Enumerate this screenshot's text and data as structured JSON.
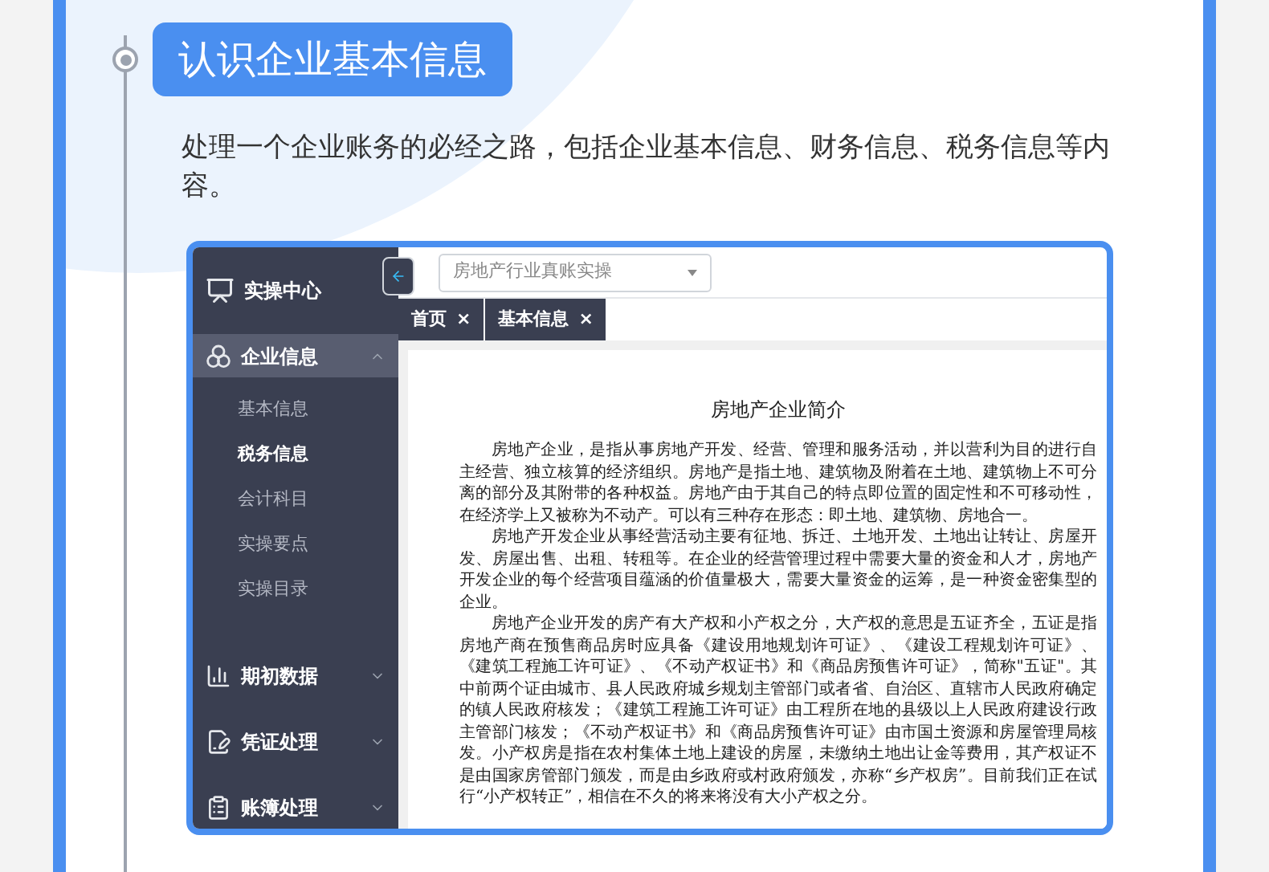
{
  "section": {
    "title": "认识企业基本信息",
    "description": "处理一个企业账务的必经之路，包括企业基本信息、财务信息、税务信息等内容。"
  },
  "screenshot": {
    "sidebar": {
      "header": "实操中心",
      "items": [
        {
          "kind": "group",
          "label": "企业信息",
          "selected": true,
          "expanded": true,
          "children": [
            {
              "label": "基本信息",
              "selected": false
            },
            {
              "label": "税务信息",
              "selected": true
            },
            {
              "label": "会计科目",
              "selected": false
            },
            {
              "label": "实操要点",
              "selected": false
            },
            {
              "label": "实操目录",
              "selected": false
            }
          ]
        },
        {
          "kind": "group",
          "label": "期初数据",
          "selected": false,
          "expanded": false
        },
        {
          "kind": "group",
          "label": "凭证处理",
          "selected": false,
          "expanded": false
        },
        {
          "kind": "group",
          "label": "账簿处理",
          "selected": false,
          "expanded": false
        }
      ]
    },
    "dropdown": {
      "value": "房地产行业真账实操"
    },
    "tabs": [
      {
        "label": "首页",
        "close": "×"
      },
      {
        "label": "基本信息",
        "close": "×"
      }
    ],
    "document": {
      "title": "房地产企业简介",
      "paragraphs": [
        "房地产企业，是指从事房地产开发、经营、管理和服务活动，并以营利为目的进行自主经营、独立核算的经济组织。房地产是指土地、建筑物及附着在土地、建筑物上不可分离的部分及其附带的各种权益。房地产由于其自己的特点即位置的固定性和不可移动性，在经济学上又被称为不动产。可以有三种存在形态：即土地、建筑物、房地合一。",
        "房地产开发企业从事经营活动主要有征地、拆迁、土地开发、土地出让转让、房屋开发、房屋出售、出租、转租等。在企业的经营管理过程中需要大量的资金和人才，房地产开发企业的每个经营项目蕴涵的价值量极大，需要大量资金的运筹，是一种资金密集型的企业。",
        "房地产企业开发的房产有大产权和小产权之分，大产权的意思是五证齐全，五证是指房地产商在预售商品房时应具备《建设用地规划许可证》、《建设工程规划许可证》、《建筑工程施工许可证》、《不动产权证书》和《商品房预售许可证》，简称\"五证\"。其中前两个证由城市、县人民政府城乡规划主管部门或者省、自治区、直辖市人民政府确定的镇人民政府核发；《建筑工程施工许可证》由工程所在地的县级以上人民政府建设行政主管部门核发；《不动产权证书》和《商品房预售许可证》由市国土资源和房屋管理局核发。小产权房是指在农村集体土地上建设的房屋，未缴纳土地出让金等费用，其产权证不是由国家房管部门颁发，而是由乡政府或村政府颁发，亦称“乡产权房”。目前我们正在试行“小产权转正”，相信在不久的将来将没有大小产权之分。"
      ]
    }
  }
}
